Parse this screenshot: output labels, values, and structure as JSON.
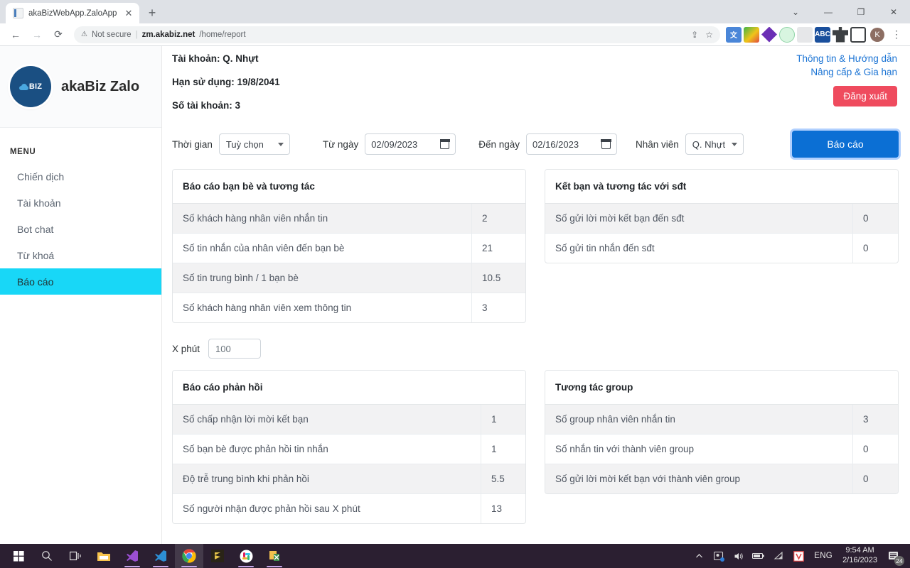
{
  "browser": {
    "tab": {
      "title": "akaBizWebApp.ZaloApp",
      "close": "✕",
      "favicon": "document-icon"
    },
    "new_tab": "+",
    "window_controls": {
      "minimize": "—",
      "maximize": "❐",
      "close": "✕",
      "more": "⌄"
    },
    "nav": {
      "back": "←",
      "forward": "→",
      "reload": "⟳"
    },
    "omnibox": {
      "security_icon": "⚠",
      "security_text": "Not secure",
      "separator": "|",
      "url_host": "zm.akabiz.net",
      "url_path": "/home/report",
      "share_icon": "⇪",
      "bookmark_icon": "☆"
    },
    "extensions": [
      "translate-icon",
      "globe-icon",
      "diamond-icon",
      "target-icon",
      "page-icon",
      "abc-icon",
      "puzzle-icon",
      "sidepanel-icon"
    ],
    "profile_initial": "K",
    "menu_icon": "⋮"
  },
  "sidebar": {
    "logo_text": "BIZ",
    "brand": "akaBiz Zalo",
    "menu_label": "MENU",
    "items": [
      {
        "label": "Chiến dịch",
        "active": false
      },
      {
        "label": "Tài khoản",
        "active": false
      },
      {
        "label": "Bot chat",
        "active": false
      },
      {
        "label": "Từ khoá",
        "active": false
      },
      {
        "label": "Báo cáo",
        "active": true
      }
    ]
  },
  "account": {
    "line1": "Tài khoản: Q. Nhựt",
    "line2": "Hạn sử dụng: 19/8/2041",
    "line3": "Số tài khoản: 3",
    "link_info": "Thông tin & Hướng dẫn",
    "link_upgrade": "Nâng cấp & Gia hạn",
    "logout": "Đăng xuất"
  },
  "filters": {
    "time_label": "Thời gian",
    "time_value": "Tuỳ chọn",
    "from_label": "Từ ngày",
    "from_value": "02/09/2023",
    "to_label": "Đến ngày",
    "to_value": "02/16/2023",
    "staff_label": "Nhân viên",
    "staff_value": "Q. Nhựt",
    "report_button": "Báo cáo"
  },
  "x_minutes": {
    "label": "X phút",
    "value": "100"
  },
  "cards": {
    "friends": {
      "title": "Báo cáo bạn bè và tương tác",
      "rows": [
        {
          "label": "Số khách hàng nhân viên nhắn tin",
          "value": "2"
        },
        {
          "label": "Số tin nhắn của nhân viên đến bạn bè",
          "value": "21"
        },
        {
          "label": "Số tin trung bình / 1 bạn bè",
          "value": "10.5"
        },
        {
          "label": "Số khách hàng nhân viên xem thông tin",
          "value": "3"
        }
      ]
    },
    "phone": {
      "title": "Kết bạn và tương tác với sđt",
      "rows": [
        {
          "label": "Số gửi lời mời kết bạn đến sđt",
          "value": "0"
        },
        {
          "label": "Số gửi tin nhắn đến sđt",
          "value": "0"
        }
      ]
    },
    "feedback": {
      "title": "Báo cáo phản hồi",
      "rows": [
        {
          "label": "Số chấp nhận lời mời kết bạn",
          "value": "1"
        },
        {
          "label": "Số bạn bè được phản hồi tin nhắn",
          "value": "1"
        },
        {
          "label": "Độ trễ trung bình khi phản hồi",
          "value": "5.5"
        },
        {
          "label": "Số người nhận được phản hồi sau X phút",
          "value": "13"
        }
      ]
    },
    "group": {
      "title": "Tương tác group",
      "rows": [
        {
          "label": "Số group nhân viên nhắn tin",
          "value": "3"
        },
        {
          "label": "Số nhắn tin với thành viên group",
          "value": "0"
        },
        {
          "label": "Số gửi lời mời kết bạn với thành viên group",
          "value": "0"
        }
      ]
    }
  },
  "taskbar": {
    "start": "windows-icon",
    "items": [
      "search-icon",
      "task-view-icon",
      "file-explorer-icon",
      "visual-studio-icon",
      "vscode-icon",
      "chrome-icon",
      "sublime-icon",
      "slack-icon",
      "app-icon"
    ],
    "tray": [
      "chevron-up-icon",
      "teams-icon",
      "volume-icon",
      "battery-icon",
      "wifi-icon",
      "v-icon"
    ],
    "language": "ENG",
    "time": "9:54 AM",
    "date": "2/16/2023",
    "notification_count": "24"
  },
  "colors": {
    "accent_blue": "#0b6fd4",
    "active_nav": "#18d7f7",
    "logout_red": "#ef4b5e",
    "link_blue": "#1a73d4"
  }
}
